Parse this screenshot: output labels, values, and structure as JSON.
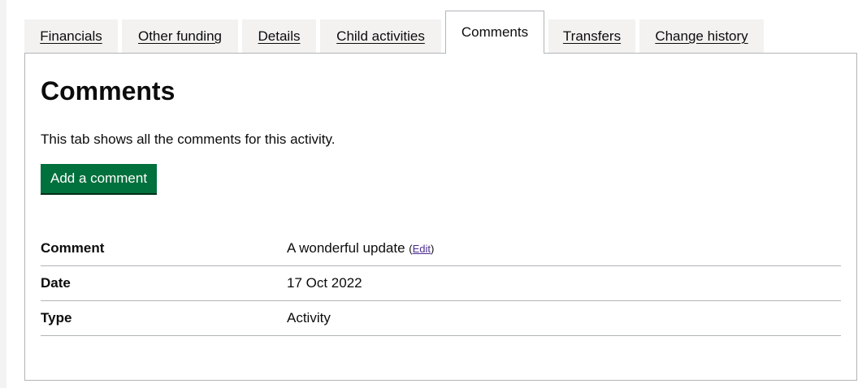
{
  "tabs": [
    {
      "label": "Financials"
    },
    {
      "label": "Other funding"
    },
    {
      "label": "Details"
    },
    {
      "label": "Child activities"
    },
    {
      "label": "Comments"
    },
    {
      "label": "Transfers"
    },
    {
      "label": "Change history"
    }
  ],
  "selected_tab": "Comments",
  "panel": {
    "heading": "Comments",
    "intro": "This tab shows all the comments for this activity.",
    "add_button_label": "Add a comment"
  },
  "summary": {
    "comment_key": "Comment",
    "comment_value": "A wonderful update",
    "edit_open": "(",
    "edit_label": "Edit",
    "edit_close": ")",
    "date_key": "Date",
    "date_value": "17 Oct 2022",
    "type_key": "Type",
    "type_value": "Activity"
  },
  "colors": {
    "button_green": "#00703c",
    "visited_link": "#4c2c92",
    "border_grey": "#b1b4b6",
    "tab_background": "#f3f2f1"
  }
}
